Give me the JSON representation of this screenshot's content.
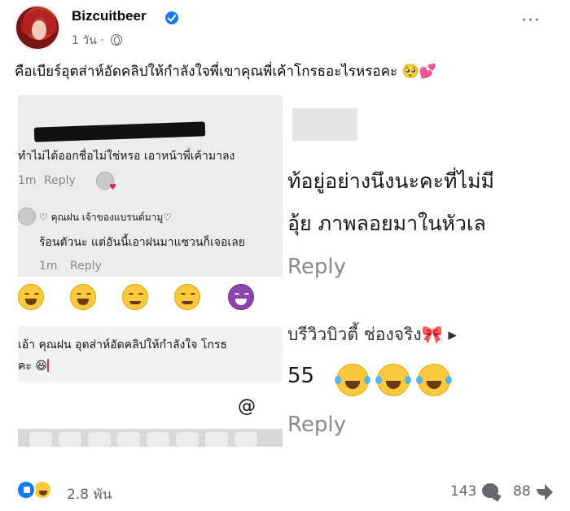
{
  "post": {
    "author": "Bizcuitbeer",
    "time": "1 วัน ·",
    "caption": "คือเบียร์อุตส่าห์อัดคลิปให้กำลังใจพี่เขาคุณพี่เค้าโกรธอะไรหรอคะ 🥺💕"
  },
  "left_shot": {
    "comment1": "ทำไม่ได้ออกชื่อไม่ใช่หรอ เอาหน้าพี่เค้ามาลง",
    "comment1_time": "1m",
    "reply_label": "Reply",
    "comment2_name": "♡ คุณฝน เจ้าของแบรนด์มามู♡",
    "comment2_text": "ร้อนตัวนะ แต่อันนี้เอาฝนมาแซวนก็เจอเลย",
    "comment2_time": "1m",
    "compose_line1": "เอ้า คุณฝน อุตส่าห์อัดคลิปให้กำลังใจ โกรธ",
    "compose_line2": "คะ 😆",
    "at_symbol": "@"
  },
  "right_shot": {
    "line1": "ท้อยู่อย่างนึงนะคะที่ไม่มี",
    "line2": "อุ้ย ภาพลอยมาในหัวเล",
    "reply1": "Reply",
    "commenter": "บรีวิวบิวตี้ ช่องจริง🎀 ▸",
    "laugh_text": "55",
    "reply2": "Reply"
  },
  "footer": {
    "reactions": "2.8 พัน",
    "comments": "143",
    "shares": "88"
  },
  "colors": {
    "accent": "#1877f2",
    "muted": "#65676b"
  }
}
